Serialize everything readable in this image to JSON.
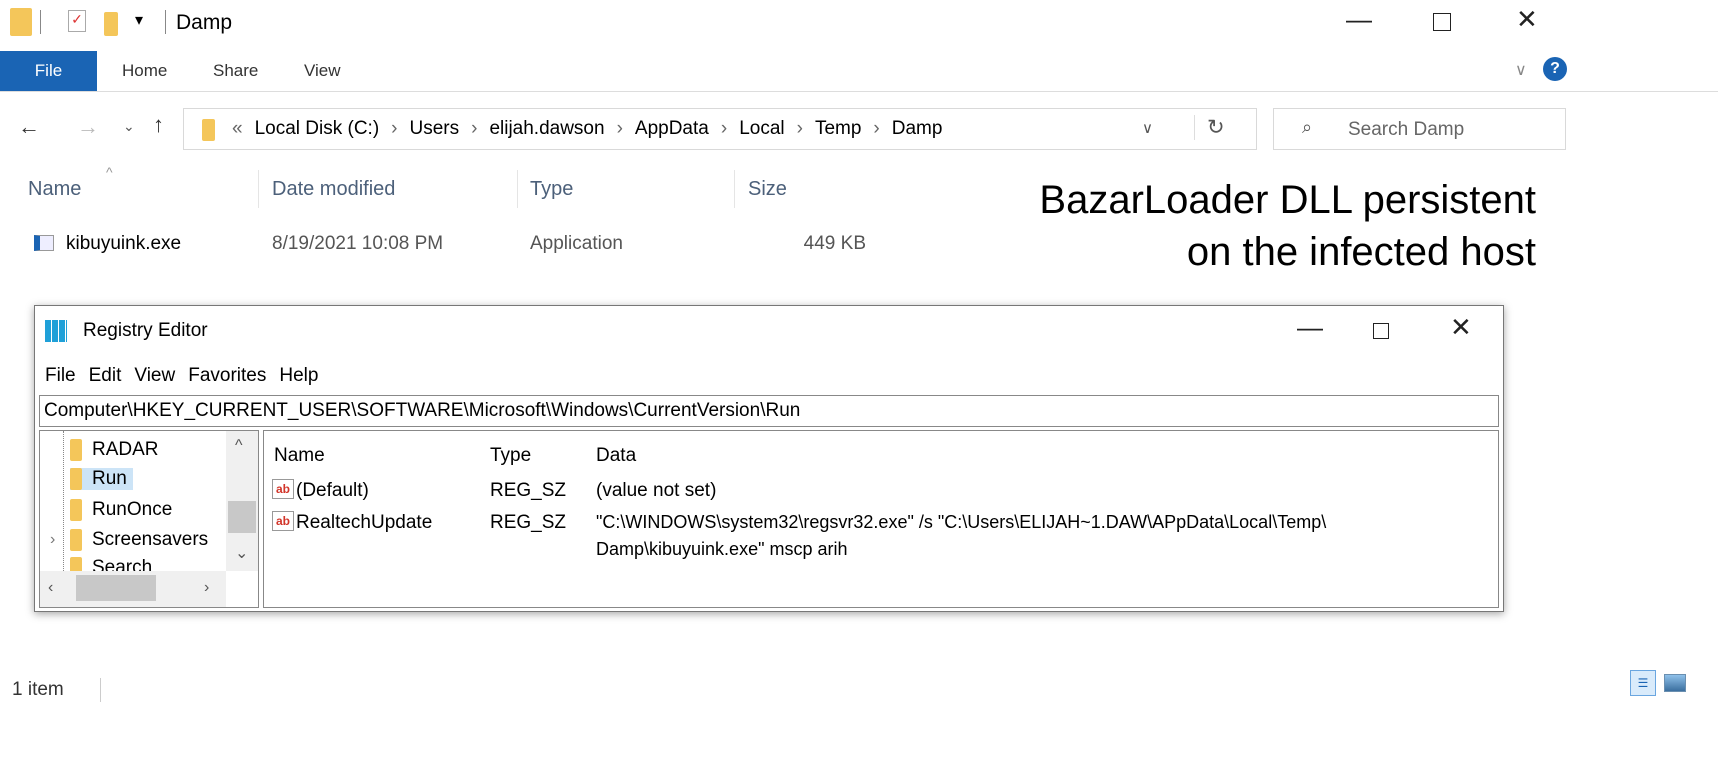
{
  "explorer": {
    "title": "Damp",
    "ribbon_tabs": [
      "File",
      "Home",
      "Share",
      "View"
    ],
    "breadcrumb": [
      "Local Disk (C:)",
      "Users",
      "elijah.dawson",
      "AppData",
      "Local",
      "Temp",
      "Damp"
    ],
    "search_placeholder": "Search Damp",
    "columns": [
      "Name",
      "Date modified",
      "Type",
      "Size"
    ],
    "files": [
      {
        "name": "kibuyuink.exe",
        "date": "8/19/2021 10:08 PM",
        "type": "Application",
        "size": "449 KB"
      }
    ],
    "status": "1 item",
    "help": "?"
  },
  "annotation": {
    "line1": "BazarLoader DLL persistent",
    "line2": "on the infected host"
  },
  "regedit": {
    "title": "Registry Editor",
    "menu": [
      "File",
      "Edit",
      "View",
      "Favorites",
      "Help"
    ],
    "path": "Computer\\HKEY_CURRENT_USER\\SOFTWARE\\Microsoft\\Windows\\CurrentVersion\\Run",
    "tree": [
      "RADAR",
      "Run",
      "RunOnce",
      "Screensavers",
      "Search"
    ],
    "columns": [
      "Name",
      "Type",
      "Data"
    ],
    "values": [
      {
        "name": "(Default)",
        "type": "REG_SZ",
        "data": "(value not set)"
      },
      {
        "name": "RealtechUpdate",
        "type": "REG_SZ",
        "data": "\"C:\\WINDOWS\\system32\\regsvr32.exe\"  /s \"C:\\Users\\ELIJAH~1.DAW\\APpData\\Local\\Temp\\",
        "data2": "Damp\\kibuyuink.exe\"  mscp  arih"
      }
    ]
  }
}
